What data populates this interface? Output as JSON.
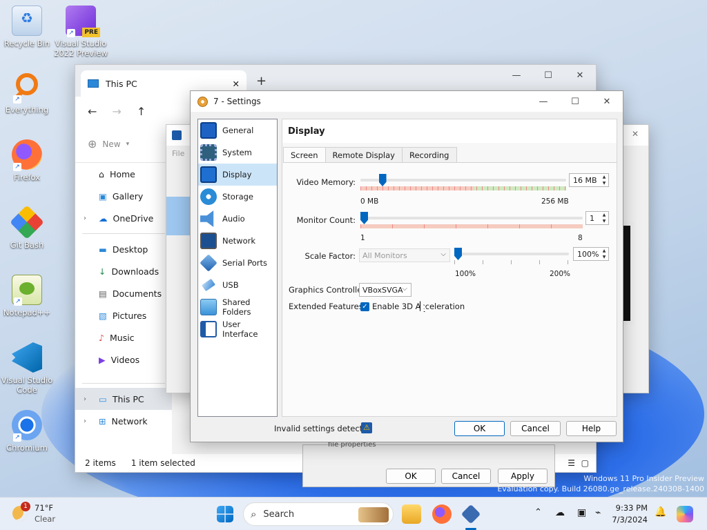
{
  "desktop": {
    "icons": [
      {
        "label": "Recycle Bin",
        "name": "recycle-bin-icon"
      },
      {
        "label": "Visual Studio 2022 Preview",
        "name": "visual-studio-icon",
        "badge": "PRE"
      },
      {
        "label": "Everything",
        "name": "everything-search-icon"
      },
      {
        "label": "Firefox",
        "name": "firefox-icon"
      },
      {
        "label": "Git Bash",
        "name": "git-bash-icon"
      },
      {
        "label": "Notepad++",
        "name": "notepad-plus-plus-icon"
      },
      {
        "label": "Visual Studio Code",
        "name": "vscode-icon"
      },
      {
        "label": "Chromium",
        "name": "chromium-icon"
      }
    ]
  },
  "explorer": {
    "tab_title": "This PC",
    "new_label": "New",
    "file_label": "File",
    "sidebar": [
      {
        "label": "Home"
      },
      {
        "label": "Gallery"
      },
      {
        "label": "OneDrive"
      },
      {
        "label": "Desktop"
      },
      {
        "label": "Downloads"
      },
      {
        "label": "Documents"
      },
      {
        "label": "Pictures"
      },
      {
        "label": "Music"
      },
      {
        "label": "Videos"
      },
      {
        "label": "This PC"
      },
      {
        "label": "Network"
      }
    ],
    "status_items": "2 items",
    "status_selected": "1 item selected"
  },
  "properties_dialog": {
    "partial_text": "file properties",
    "ok": "OK",
    "cancel": "Cancel",
    "apply": "Apply"
  },
  "settings": {
    "title": "7 - Settings",
    "nav": [
      {
        "label": "General",
        "icon": "general-icon"
      },
      {
        "label": "System",
        "icon": "system-icon"
      },
      {
        "label": "Display",
        "icon": "display-icon"
      },
      {
        "label": "Storage",
        "icon": "storage-icon"
      },
      {
        "label": "Audio",
        "icon": "audio-icon"
      },
      {
        "label": "Network",
        "icon": "network-icon"
      },
      {
        "label": "Serial Ports",
        "icon": "serial-ports-icon"
      },
      {
        "label": "USB",
        "icon": "usb-icon"
      },
      {
        "label": "Shared Folders",
        "icon": "shared-folders-icon"
      },
      {
        "label": "User Interface",
        "icon": "user-interface-icon"
      }
    ],
    "selected_nav": "Display",
    "section_title": "Display",
    "tabs": [
      {
        "label": "Screen"
      },
      {
        "label": "Remote Display"
      },
      {
        "label": "Recording"
      }
    ],
    "video_memory": {
      "label": "Video Memory:",
      "value": "16 MB",
      "min": "0 MB",
      "max": "256 MB",
      "level": 0.0625
    },
    "monitor_count": {
      "label": "Monitor Count:",
      "value": "1",
      "min": "1",
      "max": "8",
      "level": 0
    },
    "scale_factor": {
      "label": "Scale Factor:",
      "combo": "All Monitors",
      "value": "100%",
      "min": "100%",
      "max": "200%",
      "level": 0
    },
    "graphics_controller": {
      "label": "Graphics Controller:",
      "value": "VBoxSVGA"
    },
    "extended_features": {
      "label": "Extended Features:",
      "checkbox": "Enable 3D Acceleration",
      "checked": true
    },
    "footer": {
      "invalid": "Invalid settings detected",
      "ok": "OK",
      "cancel": "Cancel",
      "help": "Help"
    }
  },
  "taskbar": {
    "weather_temp": "71°F",
    "weather_desc": "Clear",
    "weather_badge": "1",
    "search": "Search",
    "time": "9:33 PM",
    "date": "7/3/2024"
  },
  "watermark": {
    "line1": "Windows 11 Pro Insider Preview",
    "line2": "Evaluation copy. Build 26080.ge_release.240308-1400"
  },
  "colors": {
    "accent": "#0067c0",
    "selection": "#cce4f7",
    "taskbar": "#e8eef7"
  }
}
